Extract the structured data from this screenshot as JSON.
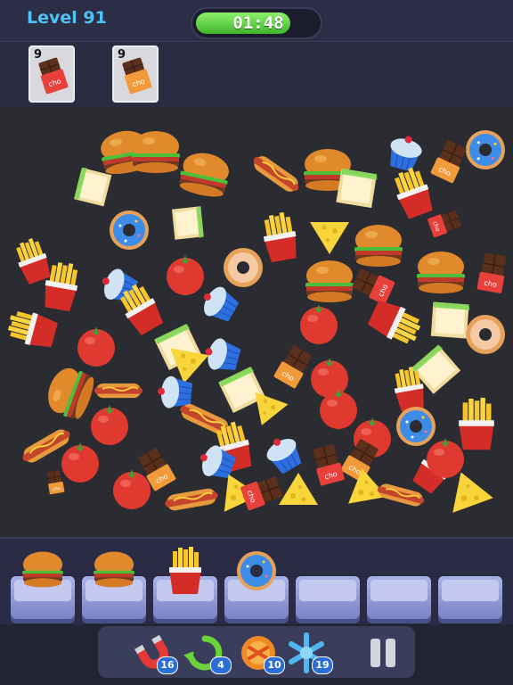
{
  "header": {
    "level_text": "Level 91",
    "timer_text": "01:48",
    "timer_fraction": 0.78
  },
  "goals": [
    {
      "count": "9",
      "item": "chocolate-bar-red",
      "wrapper_color": "#e8403a"
    },
    {
      "count": "9",
      "item": "chocolate-bar-orange",
      "wrapper_color": "#f19a3a"
    }
  ],
  "tray": {
    "slots": [
      "burger",
      "burger",
      "fries",
      "donut",
      "empty",
      "empty",
      "empty"
    ]
  },
  "boosters": [
    {
      "name": "magnet-icon",
      "count": "16"
    },
    {
      "name": "undo-icon",
      "count": "4"
    },
    {
      "name": "shuffle-icon",
      "count": "10"
    },
    {
      "name": "freeze-icon",
      "count": "19"
    }
  ],
  "colors": {
    "accent": "#4fc3f7",
    "timer_green": "#3fb52a",
    "tray_slot": "#a9b2e6"
  }
}
